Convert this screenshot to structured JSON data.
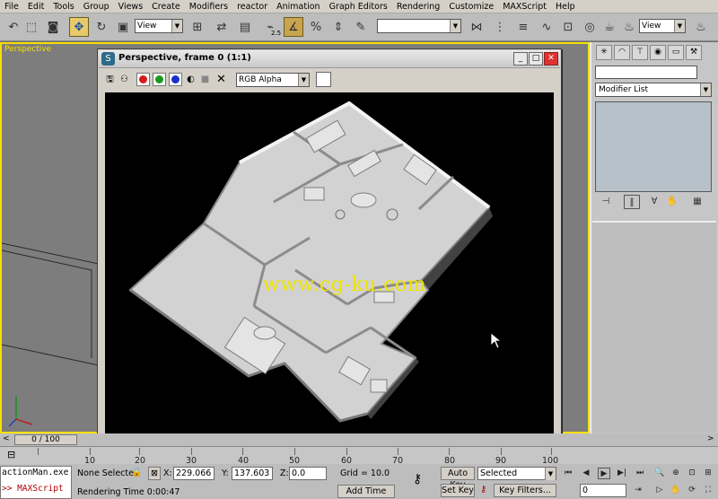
{
  "menu": [
    "File",
    "Edit",
    "Tools",
    "Group",
    "Views",
    "Create",
    "Modifiers",
    "reactor",
    "Animation",
    "Graph Editors",
    "Rendering",
    "Customize",
    "MAXScript",
    "Help"
  ],
  "toolbar": {
    "coord_system": "View",
    "named_selection": "",
    "right_view_dropdown": "View",
    "small_counter": "2.5"
  },
  "viewport": {
    "label": "Perspective"
  },
  "render_window": {
    "title": "Perspective, frame 0 (1:1)",
    "channel_select": "RGB Alpha",
    "watermark": "www.cg-ku.com"
  },
  "command_panel": {
    "modifier_list": "Modifier List"
  },
  "timeline": {
    "frame_counter": "0 / 100",
    "ticks": [
      "10",
      "20",
      "30",
      "40",
      "50",
      "60",
      "70",
      "80",
      "90",
      "100"
    ]
  },
  "status": {
    "script_line1": "actionMan.exe",
    "script_line2": ">> MAXScript",
    "selection": "None Selecte",
    "x_label": "X:",
    "x_value": "229.066",
    "y_label": "Y:",
    "y_value": "137.603",
    "z_label": "Z:",
    "z_value": "0.0",
    "grid": "Grid = 10.0",
    "render_time": "Rendering Time  0:00:47",
    "add_time_tag": "Add Time Tag",
    "auto_key": "Auto Key",
    "set_key": "Set Key",
    "key_mode": "Selected",
    "key_filters": "Key Filters...",
    "current_frame": "0"
  },
  "colors": {
    "active_viewport_border": "#f5e000",
    "watermark": "#f0e400",
    "script_error_text": "#b00000"
  }
}
